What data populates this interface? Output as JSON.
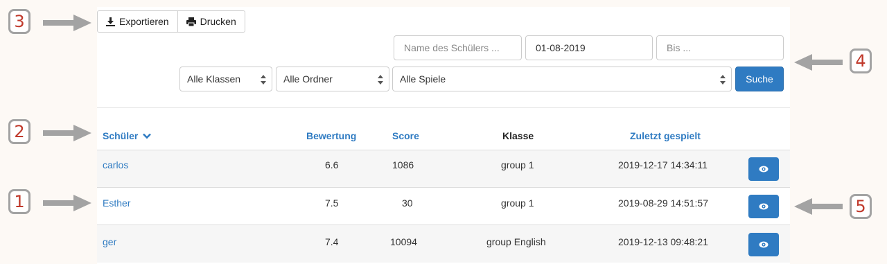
{
  "toolbar": {
    "export_label": "Exportieren",
    "print_label": "Drucken"
  },
  "filters": {
    "student_name_placeholder": "Name des Schülers ...",
    "date_from_value": "01-08-2019",
    "date_to_placeholder": "Bis ...",
    "class_select": "Alle Klassen",
    "folder_select": "Alle Ordner",
    "game_select": "Alle Spiele",
    "search_label": "Suche"
  },
  "table": {
    "headers": {
      "student": "Schüler",
      "rating": "Bewertung",
      "score": "Score",
      "class": "Klasse",
      "last_played": "Zuletzt gespielt"
    },
    "rows": [
      {
        "name": "carlos",
        "rating": "6.6",
        "score": "1086",
        "class": "group 1",
        "last_played": "2019-12-17 14:34:11"
      },
      {
        "name": "Esther",
        "rating": "7.5",
        "score": "30",
        "class": "group 1",
        "last_played": "2019-08-29 14:51:57"
      },
      {
        "name": "ger",
        "rating": "7.4",
        "score": "10094",
        "class": "group English",
        "last_played": "2019-12-13 09:48:21"
      }
    ]
  },
  "callouts": {
    "c1": "1",
    "c2": "2",
    "c3": "3",
    "c4": "4",
    "c5": "5"
  },
  "colors": {
    "accent": "#2f7bc2",
    "callout_text": "#c0392b",
    "callout_border": "#a3a3a3"
  },
  "icons": {
    "export": "download-icon",
    "print": "printer-icon",
    "sort": "chevron-down-icon",
    "view": "eye-icon",
    "select": "select-arrows-icon"
  }
}
